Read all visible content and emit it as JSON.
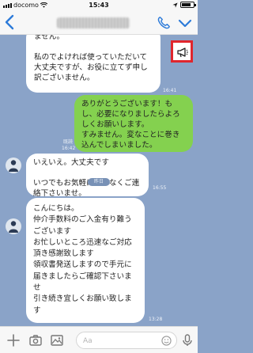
{
  "status_bar": {
    "carrier": "docomo",
    "time": "15:43",
    "battery_level": 0.8
  },
  "nav": {
    "back_icon": "chevron-left",
    "call_icon": "phone",
    "menu_icon": "chevron-down"
  },
  "messages": [
    {
      "side": "in",
      "text": "ません。\n\n私のでよければ使っていただいて大丈夫ですが、お役に立てず申し訳ございません。",
      "time": "16:41"
    },
    {
      "side": "out",
      "text": "ありがとうございます！もし、必要になりましたらよろしくお願いします。\nすみません。変なことに巻き込んでしまいました。",
      "read": "既読",
      "time": "16:42"
    },
    {
      "side": "in",
      "text": "いえいえ。大丈夫です\n\nいつでもお気軽になんなくご連絡下さいませ。",
      "time": "16:55"
    },
    {
      "side": "in",
      "text": "こんにちは。\n仲介手数料のご入金有り難うございます\nお忙しいところ迅速なご対応頂き感謝致します\n領収書発送しますので手元に届きましたらご確認下さいませ\n引き続き宜しくお願い致します",
      "time": "13:28"
    }
  ],
  "date_separator": "昨日",
  "input": {
    "placeholder": "Aa"
  },
  "colors": {
    "chat_background": "#8aa3c8",
    "outgoing_bubble": "#84d14f",
    "accent": "#2d7bd9",
    "highlight_box": "#e0262d"
  }
}
